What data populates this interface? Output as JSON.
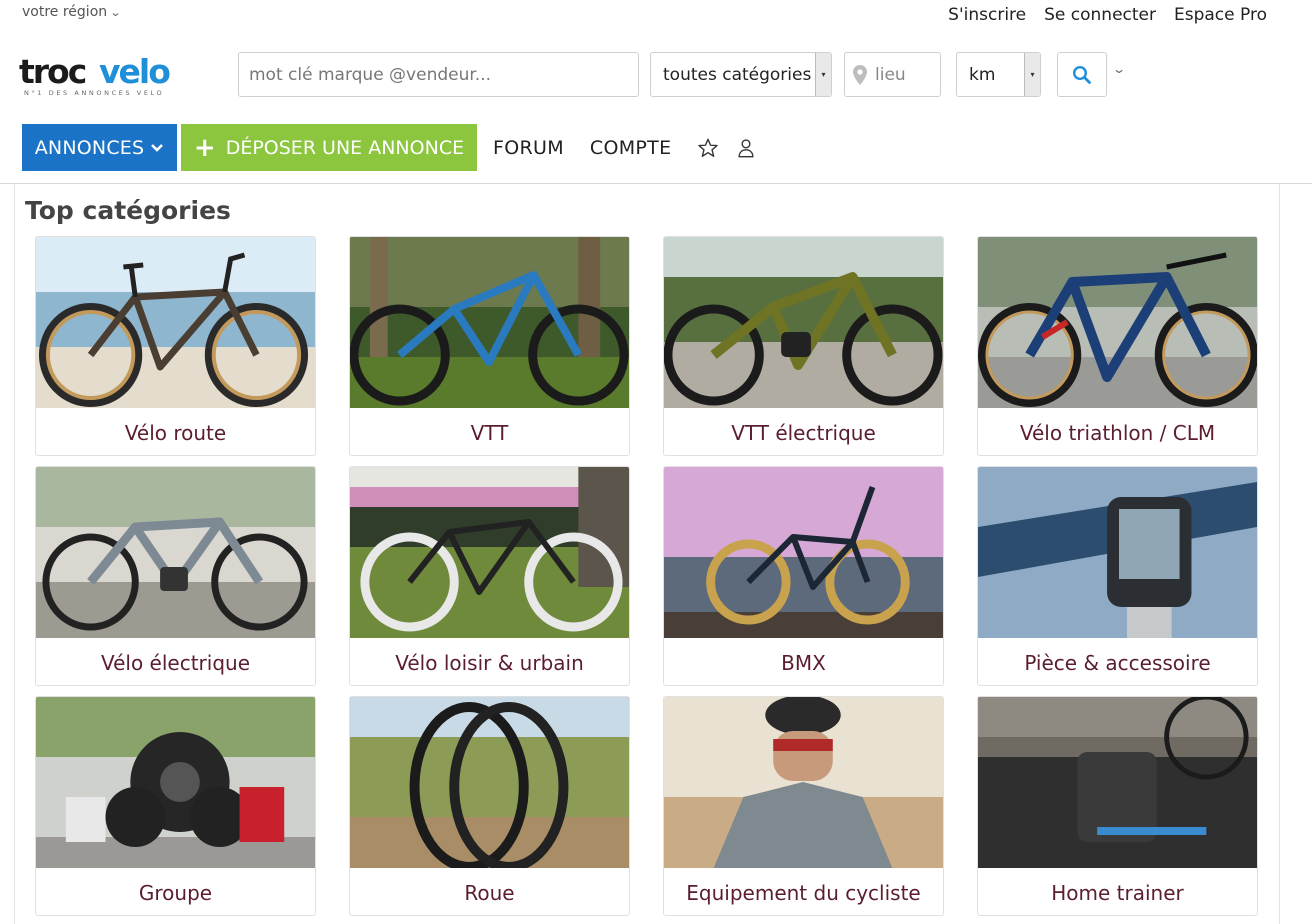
{
  "header": {
    "region_label": "votre région",
    "links": [
      "S'inscrire",
      "Se connecter",
      "Espace Pro"
    ],
    "logo_text_a": "troc",
    "logo_text_b": "velo",
    "logo_tagline": "N°1 DES ANNONCES VELO"
  },
  "search": {
    "placeholder": "mot clé marque @vendeur...",
    "category_value": "toutes catégories",
    "location_placeholder": "lieu",
    "distance_value": "km"
  },
  "nav": {
    "annonces": "ANNONCES",
    "deposer": "DÉPOSER UNE ANNONCE",
    "forum": "FORUM",
    "compte": "COMPTE"
  },
  "colors": {
    "primary_blue": "#1a73c6",
    "cta_green": "#8cc63f",
    "category_text": "#5a1e2e"
  },
  "main": {
    "title": "Top catégories",
    "categories": [
      {
        "label": "Vélo route",
        "icon": "road-bike-photo"
      },
      {
        "label": "VTT",
        "icon": "mountain-bike-photo"
      },
      {
        "label": "VTT électrique",
        "icon": "electric-mtb-photo"
      },
      {
        "label": "Vélo triathlon / CLM",
        "icon": "triathlon-bike-photo"
      },
      {
        "label": "Vélo électrique",
        "icon": "ebike-photo"
      },
      {
        "label": "Vélo loisir & urbain",
        "icon": "city-bike-photo"
      },
      {
        "label": "BMX",
        "icon": "bmx-photo"
      },
      {
        "label": "Pièce & accessoire",
        "icon": "bike-computer-photo"
      },
      {
        "label": "Groupe",
        "icon": "groupset-photo"
      },
      {
        "label": "Roue",
        "icon": "wheels-photo"
      },
      {
        "label": "Equipement du cycliste",
        "icon": "cyclist-photo"
      },
      {
        "label": "Home trainer",
        "icon": "home-trainer-photo"
      }
    ]
  }
}
